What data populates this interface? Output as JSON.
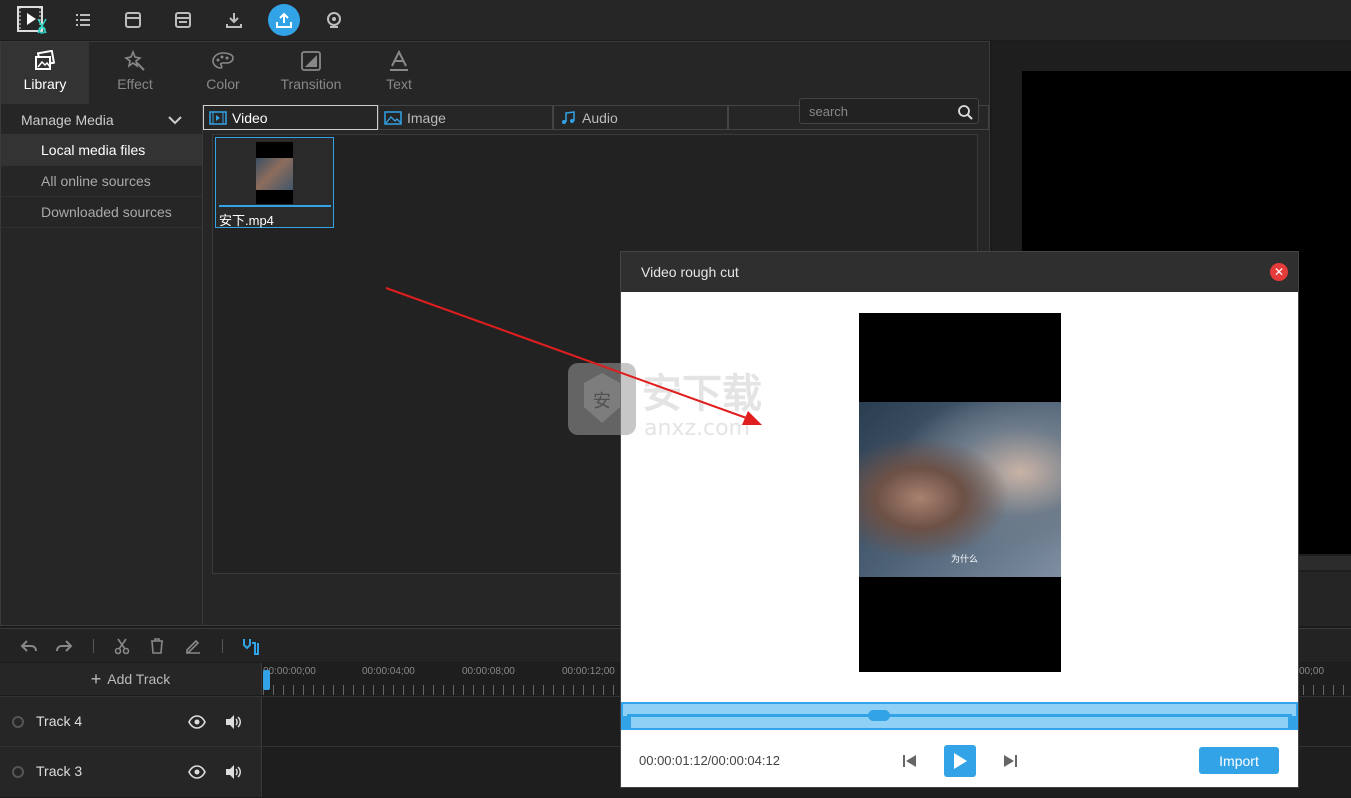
{
  "toolbar": {
    "icons": [
      "logo-icon",
      "menu-icon",
      "new-project-icon",
      "save-icon",
      "download-icon",
      "export-icon",
      "record-icon"
    ]
  },
  "tabs": [
    {
      "label": "Library",
      "icon": "library-icon"
    },
    {
      "label": "Effect",
      "icon": "effect-icon"
    },
    {
      "label": "Color",
      "icon": "color-palette-icon"
    },
    {
      "label": "Transition",
      "icon": "transition-icon"
    },
    {
      "label": "Text",
      "icon": "text-icon"
    }
  ],
  "sidebar": {
    "header": "Manage Media",
    "items": [
      {
        "label": "Local media files"
      },
      {
        "label": "All online sources"
      },
      {
        "label": "Downloaded sources"
      }
    ]
  },
  "media_tabs": [
    {
      "label": "Video"
    },
    {
      "label": "Image"
    },
    {
      "label": "Audio"
    }
  ],
  "search": {
    "placeholder": "search"
  },
  "media": [
    {
      "name": "安下.mp4"
    }
  ],
  "timeline": {
    "add_track": "Add Track",
    "ruler_labels": [
      "00:00:00;00",
      "00:00:04;00",
      "00:00:08;00",
      "00:00:12;00",
      "00;00"
    ],
    "tracks": [
      {
        "name": "Track 4"
      },
      {
        "name": "Track 3"
      }
    ]
  },
  "watermark": {
    "text_cn": "安下载",
    "text_en": "anxz.com"
  },
  "dialog": {
    "title": "Video rough cut",
    "subtitle": "为什么",
    "time": "00:00:01:12/00:00:04:12",
    "import_label": "Import"
  },
  "colors": {
    "accent": "#31a3e6",
    "close": "#e53b3b",
    "arrow": "#e01e1e"
  }
}
